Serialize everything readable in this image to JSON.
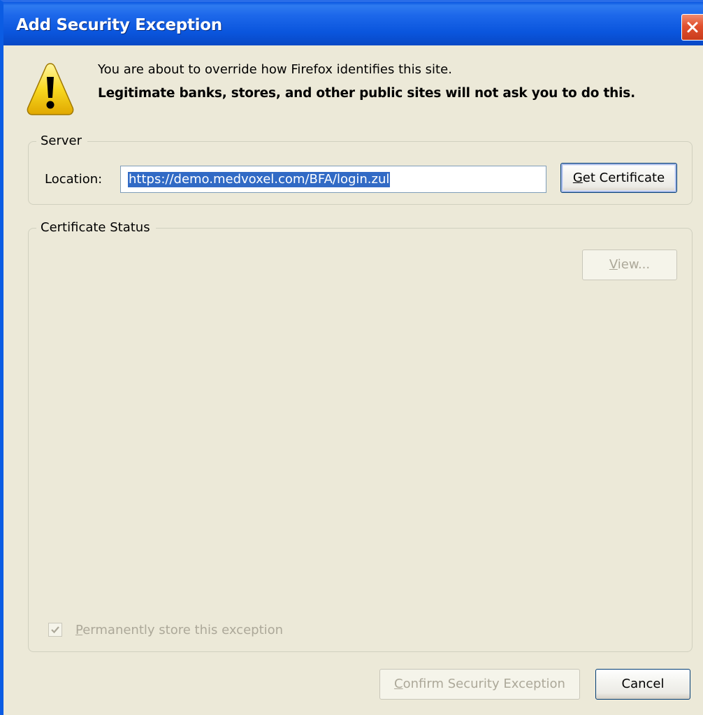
{
  "window": {
    "title": "Add Security Exception"
  },
  "header": {
    "icon": "warning-icon",
    "message": "You are about to override how Firefox identifies this site.",
    "warning": "Legitimate banks, stores, and other public sites will not ask you to do this."
  },
  "server": {
    "caption": "Server",
    "location_label": "Location:",
    "location_value": "https://demo.medvoxel.com/BFA/login.zul",
    "get_certificate_prefix": "G",
    "get_certificate_rest": "et Certificate"
  },
  "certificate_status": {
    "caption": "Certificate Status",
    "view_prefix": "V",
    "view_rest": "iew...",
    "permanent_prefix": "P",
    "permanent_rest": "ermanently store this exception",
    "permanent_checked": true
  },
  "footer": {
    "confirm_prefix": "C",
    "confirm_rest": "onfirm Security Exception",
    "cancel_label": "Cancel"
  },
  "colors": {
    "titlebar": "#0a55dd",
    "dialog_bg": "#ece9d8",
    "selection": "#316ac5",
    "disabled_text": "#aca899",
    "close_button": "#e1502e"
  }
}
